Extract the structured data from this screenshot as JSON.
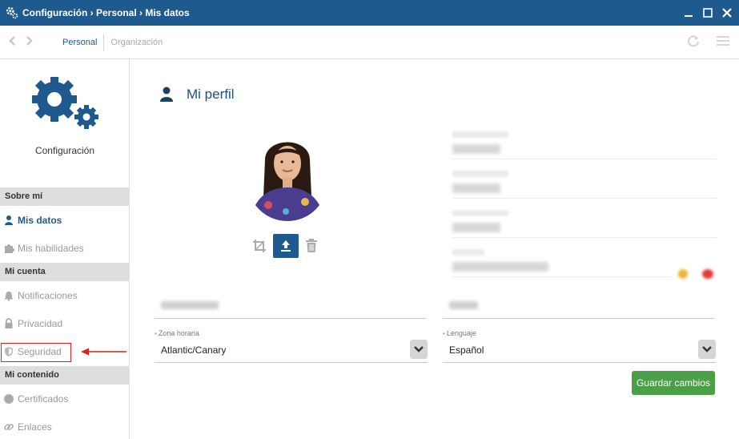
{
  "window": {
    "title": "Configuración › Personal › Mis datos"
  },
  "toolbar": {
    "tabs": [
      {
        "label": "Personal"
      },
      {
        "label": "Organización"
      }
    ]
  },
  "sidebar": {
    "app_label": "Configuración",
    "sections": [
      {
        "header": "Sobre mí",
        "items": [
          {
            "label": "Mis datos",
            "icon": "user-icon",
            "active": true
          },
          {
            "label": "Mis habilidades",
            "icon": "puzzle-icon"
          }
        ]
      },
      {
        "header": "Mi cuenta",
        "items": [
          {
            "label": "Notificaciones",
            "icon": "bell-icon"
          },
          {
            "label": "Privacidad",
            "icon": "lock-icon"
          },
          {
            "label": "Seguridad",
            "icon": "shield-icon",
            "highlighted": true
          }
        ]
      },
      {
        "header": "Mi contenido",
        "items": [
          {
            "label": "Certificados",
            "icon": "certificate-icon"
          },
          {
            "label": "Enlaces",
            "icon": "link-icon"
          }
        ]
      }
    ]
  },
  "main": {
    "title": "Mi perfil",
    "timezone": {
      "label": "Zona horaria",
      "value": "Atlantic/Canary"
    },
    "language": {
      "label": "Lenguaje",
      "value": "Español"
    },
    "save_label": "Guardar cambios"
  },
  "colors": {
    "titlebar": "#1f5a8f",
    "accent": "#1f5a8f",
    "save_button": "#4a9f47",
    "highlight": "#e0201a"
  }
}
